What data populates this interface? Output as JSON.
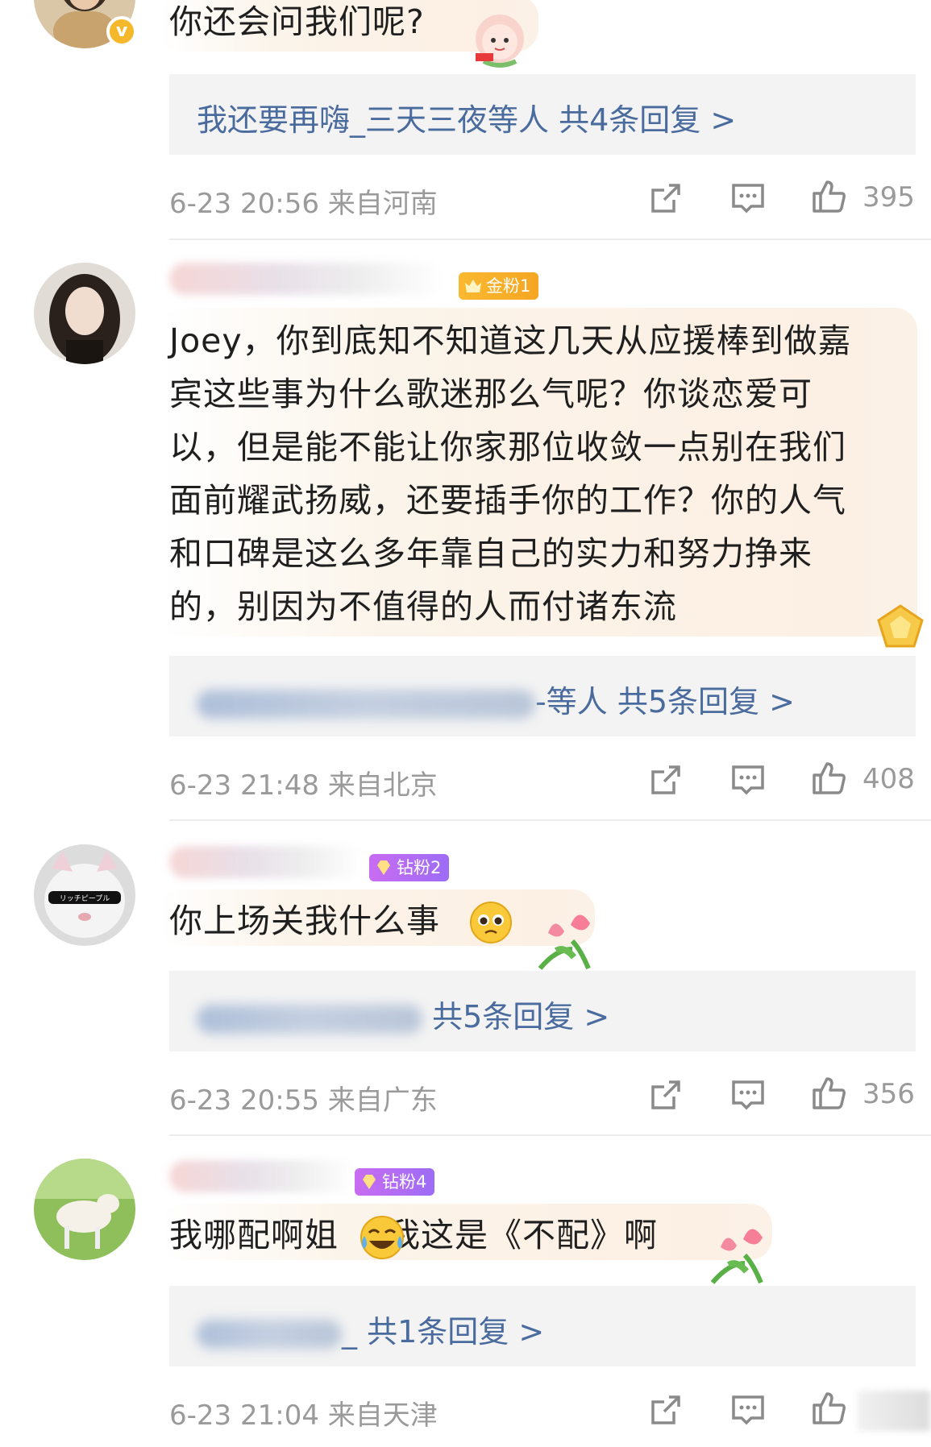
{
  "comments": [
    {
      "text": "你还会问我们呢?",
      "reply_summary": "我还要再嗨_三天三夜等人 共4条回复 >",
      "date": "6-23 20:56",
      "location": "来自河南",
      "likes": "395"
    },
    {
      "badge": "金粉1",
      "text": "Joey，你到底知不知道这几天从应援棒到做嘉宾这些事为什么歌迷那么气呢？你谈恋爱可以，但是能不能让你家那位收敛一点别在我们面前耀武扬威，还要插手你的工作？你的人气和口碑是这么多年靠自己的实力和努力挣来的，别因为不值得的人而付诸东流",
      "reply_suffix": "-等人",
      "reply_count": "共5条回复 >",
      "date": "6-23 21:48",
      "location": "来自北京",
      "likes": "408"
    },
    {
      "badge": "钻粉2",
      "text": "你上场关我什么事",
      "reply_count": "共5条回复 >",
      "date": "6-23 20:55",
      "location": "来自广东",
      "likes": "356"
    },
    {
      "badge": "钻粉4",
      "text_a": "我哪配啊姐",
      "text_b": "我这是《不配》啊",
      "reply_suffix": "_",
      "reply_count": "共1条回复 >",
      "date": "6-23 21:04",
      "location": "来自天津"
    }
  ],
  "avatar_overlay_text": "リッチピープル",
  "icons": {
    "verified": "verified-v-badge",
    "share": "share-icon",
    "comment": "comment-icon",
    "like": "thumbs-up-icon"
  },
  "colors": {
    "link_blue": "#4a6b9e",
    "meta_gray": "#9a9a9a",
    "gold_badge": "#f5a623",
    "diamond_badge": "#b06cf3",
    "verified_orange": "#f5b82a"
  }
}
